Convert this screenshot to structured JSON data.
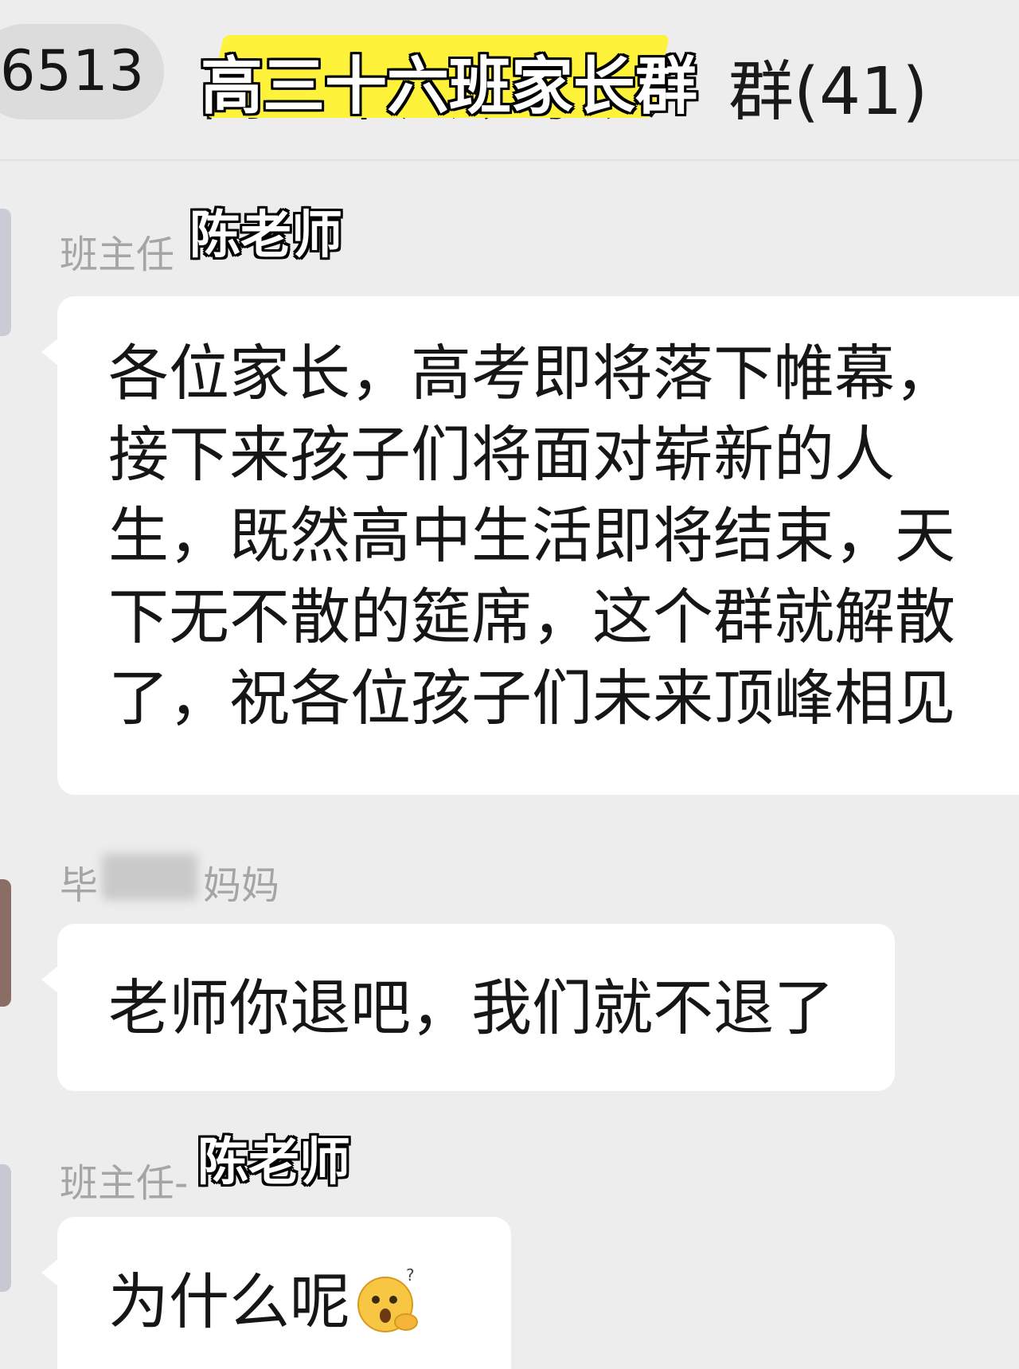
{
  "header": {
    "back_count": "6513",
    "chat_title": "高三十六班家长群",
    "member_count": "群(41)"
  },
  "messages": [
    {
      "sender_label": "班主任",
      "sender_overlay": "陈老师",
      "text": "各位家长，高考即将落下帷幕，\n接下来孩子们将面对崭新的人\n生，既然高中生活即将结束，天\n下无不散的筵席，这个群就解散\n了，祝各位孩子们未来顶峰相见"
    },
    {
      "sender_label_prefix": "毕",
      "sender_label_suffix": "妈妈",
      "text": "老师你退吧，我们就不退了"
    },
    {
      "sender_label": "班主任-",
      "sender_overlay": "陈老师",
      "text": "为什么呢",
      "emoji": "thinking-face-icon"
    }
  ],
  "colors": {
    "background": "#ededed",
    "bubble": "#ffffff",
    "highlight": "#fff23a",
    "sender_gray": "#a5a5a5"
  }
}
